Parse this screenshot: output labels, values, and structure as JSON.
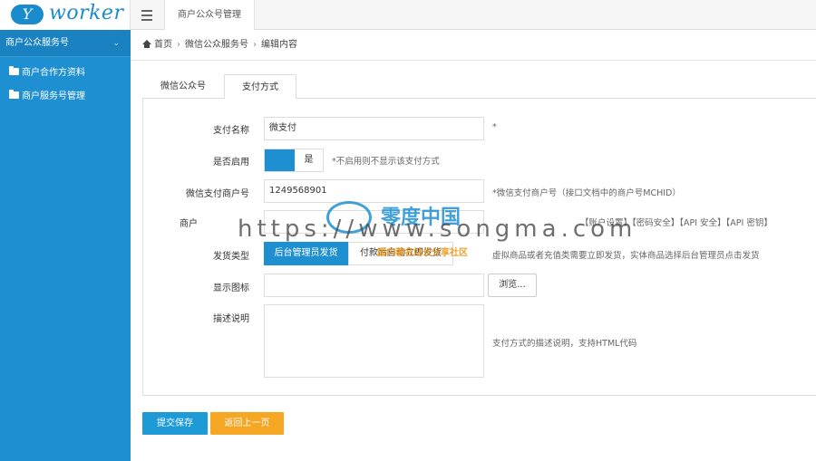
{
  "header": {
    "logo_badge": "Y",
    "logo_text": "worker",
    "active_tab": "商户公众号管理"
  },
  "sidebar": {
    "section_title": "商户公众服务号",
    "items": [
      {
        "label": "商户合作方资料"
      },
      {
        "label": "商户服务号管理"
      }
    ]
  },
  "breadcrumb": {
    "home": "首页",
    "level1": "微信公众服务号",
    "level2": "编辑内容",
    "separator": "›"
  },
  "tabs": [
    {
      "label": "微信公众号",
      "active": false
    },
    {
      "label": "支付方式",
      "active": true
    }
  ],
  "form": {
    "pay_name": {
      "label": "支付名称",
      "value": "微支付",
      "hint": "*"
    },
    "enabled": {
      "label": "是否启用",
      "toggle_label": "是",
      "on": true,
      "hint": "*不启用则不显示该支付方式"
    },
    "merchant_id": {
      "label": "微信支付商户号",
      "value": "1249568901",
      "hint": "*微信支付商户号（接口文档中的商户号MCHID）"
    },
    "merchant_key": {
      "label": "商户",
      "hint": "【账户设置】【密码安全】【API 安全】【API 密钥】"
    },
    "delivery_type": {
      "label": "发货类型",
      "option_on": "后台管理员发货",
      "option_off": "付款后自动立即发货",
      "hint": "虚拟商品或者充值类需要立即发货，实体商品选择后台管理员点击发货"
    },
    "display_icon": {
      "label": "显示图标",
      "browse_label": "浏览..."
    },
    "description": {
      "label": "描述说明",
      "hint": "支付方式的描述说明，支持HTML代码"
    }
  },
  "actions": {
    "submit_label": "提交保存",
    "back_label": "返回上一页"
  },
  "watermark": {
    "url": "https://www.songma.com",
    "brand": "零度中国",
    "subtitle": "国内著名站长分享社区"
  },
  "colors": {
    "primary": "#1e8fd0",
    "sidebar": "#1e8fd0",
    "back_button": "#f5a623"
  }
}
